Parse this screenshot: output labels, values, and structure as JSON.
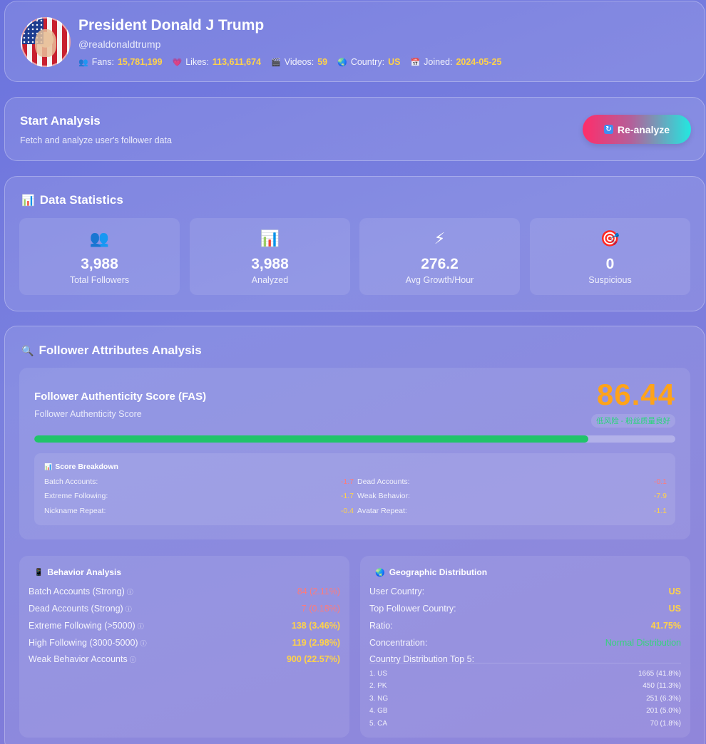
{
  "profile": {
    "name": "President Donald J Trump",
    "handle": "@realdonaldtrump",
    "stats": [
      {
        "icon": "people-icon",
        "glyph": "👥",
        "label": "Fans:",
        "value": "15,781,199"
      },
      {
        "icon": "heart-icon",
        "glyph": "💗",
        "label": "Likes:",
        "value": "113,611,674"
      },
      {
        "icon": "clapper-icon",
        "glyph": "🎬",
        "label": "Videos:",
        "value": "59"
      },
      {
        "icon": "globe-icon",
        "glyph": "🌏",
        "label": "Country:",
        "value": "US"
      },
      {
        "icon": "calendar-icon",
        "glyph": "📅",
        "label": "Joined:",
        "value": "2024-05-25"
      }
    ]
  },
  "start": {
    "title": "Start Analysis",
    "subtitle": "Fetch and analyze user's follower data",
    "button_label": "Re-analyze",
    "button_icon": "refresh-icon"
  },
  "stats": {
    "title": "Data Statistics",
    "title_icon": "bar-chart-icon",
    "items": [
      {
        "icon": "people-icon",
        "glyph": "👥",
        "value": "3,988",
        "label": "Total Followers"
      },
      {
        "icon": "bar-chart-icon",
        "glyph": "📊",
        "value": "3,988",
        "label": "Analyzed"
      },
      {
        "icon": "lightning-icon",
        "glyph": "⚡",
        "value": "276.2",
        "label": "Avg Growth/Hour"
      },
      {
        "icon": "target-icon",
        "glyph": "🎯",
        "value": "0",
        "label": "Suspicious"
      }
    ]
  },
  "attributes": {
    "title": "Follower Attributes Analysis",
    "title_icon": "magnifier-icon",
    "fas": {
      "title": "Follower Authenticity Score (FAS)",
      "subtitle": "Follower Authenticity Score",
      "score": "86.44",
      "score_fraction": 0.8644,
      "risk_label": "低风险 - 粉丝质量良好",
      "bar_color": "#20c46a"
    },
    "breakdown": {
      "title": "Score Breakdown",
      "left": [
        {
          "label": "Batch Accounts:",
          "value": "-1.7",
          "color": "red"
        },
        {
          "label": "Extreme Following:",
          "value": "-1.7",
          "color": "yellow"
        },
        {
          "label": "Nickname Repeat:",
          "value": "-0.4",
          "color": "yellow"
        }
      ],
      "right": [
        {
          "label": "Dead Accounts:",
          "value": "-0.1",
          "color": "red"
        },
        {
          "label": "Weak Behavior:",
          "value": "-7.9",
          "color": "yellow"
        },
        {
          "label": "Avatar Repeat:",
          "value": "-1.1",
          "color": "yellow"
        }
      ]
    },
    "behavior": {
      "title": "Behavior Analysis",
      "title_icon": "phone-icon",
      "rows": [
        {
          "label": "Batch Accounts (Strong)",
          "info": "ⓘ",
          "value": "84 (2.11%)",
          "color": "red"
        },
        {
          "label": "Dead Accounts (Strong)",
          "info": "ⓘ",
          "value": "7 (0.18%)",
          "color": "red"
        },
        {
          "label": "Extreme Following (>5000)",
          "info": "ⓘ",
          "value": "138 (3.46%)",
          "color": "yellow"
        },
        {
          "label": "High Following (3000-5000)",
          "info": "ⓘ",
          "value": "119 (2.98%)",
          "color": "yellow"
        },
        {
          "label": "Weak Behavior Accounts",
          "info": "ⓘ",
          "value": "900 (22.57%)",
          "color": "yellow"
        }
      ]
    },
    "geo": {
      "title": "Geographic Distribution",
      "title_icon": "globe-icon",
      "rows": [
        {
          "label": "User Country:",
          "value": "US",
          "color": "yellow"
        },
        {
          "label": "Top Follower Country:",
          "value": "US",
          "color": "yellow"
        },
        {
          "label": "Ratio:",
          "value": "41.75%",
          "color": "yellow"
        },
        {
          "label": "Concentration:",
          "value": "Normal Distribution",
          "color": "green"
        }
      ],
      "top5_title": "Country Distribution Top 5:",
      "top5": [
        {
          "rank": "1. US",
          "value": "1665 (41.8%)"
        },
        {
          "rank": "2. PK",
          "value": "450 (11.3%)"
        },
        {
          "rank": "3. NG",
          "value": "251 (6.3%)"
        },
        {
          "rank": "4. GB",
          "value": "201 (5.0%)"
        },
        {
          "rank": "5. CA",
          "value": "70 (1.8%)"
        }
      ]
    }
  }
}
